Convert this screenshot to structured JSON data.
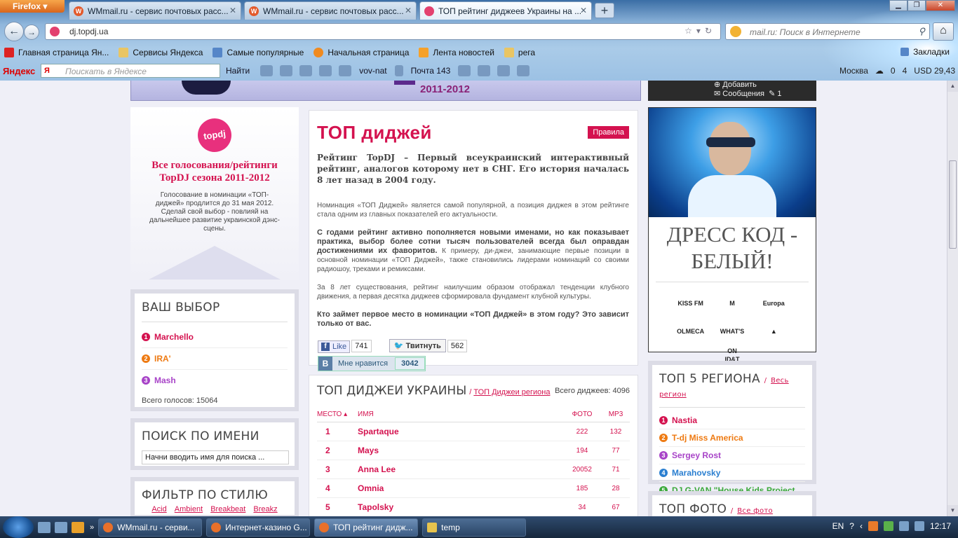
{
  "browser": {
    "app_button": "Firefox",
    "tabs": [
      {
        "title": "WMmail.ru - сервис почтовых расс...",
        "active": false
      },
      {
        "title": "WMmail.ru - сервис почтовых расс...",
        "active": false
      },
      {
        "title": "ТОП рейтинг диджеев Украины на ...",
        "active": true
      }
    ],
    "url": "dj.topdj.ua",
    "search_placeholder": "mail.ru: Поиск в Интернете",
    "bookmarks": [
      {
        "label": "Главная страница Ян...",
        "icon": "yandex-icon"
      },
      {
        "label": "Сервисы Яндекса",
        "icon": "folder-icon"
      },
      {
        "label": "Самые популярные",
        "icon": "popular-icon"
      },
      {
        "label": "Начальная страница",
        "icon": "firefox-icon"
      },
      {
        "label": "Лента новостей",
        "icon": "rss-icon"
      },
      {
        "label": "рега",
        "icon": "folder-icon"
      }
    ],
    "bookmarks_menu": "Закладки",
    "yandex_bar": {
      "logo": "Яндекс",
      "search_placeholder": "Поискать в Яндексе",
      "find_button": "Найти",
      "user": "vov-nat",
      "mail": "Почта 143",
      "city": "Москва",
      "weather_count": "0",
      "notifications": "4",
      "currency": "USD 29,43"
    }
  },
  "header": {
    "banner_years": "2011-2012",
    "user_add": "Добавить",
    "user_messages": "Сообщения",
    "messages_count": "1"
  },
  "promo": {
    "logo_text": "topdj",
    "title": "Все голосования/рейтинги TopDJ сезона 2011-2012",
    "text": "Голосование в номинации «ТОП-диджей» продлится до 31 мая 2012. Сделай свой выбор - повлияй на дальнейшее развитие украинской дэнс-сцены."
  },
  "your_choice": {
    "title": "ВАШ ВЫБОР",
    "items": [
      {
        "num": "1",
        "name": "Marchello",
        "color": "#d4124f"
      },
      {
        "num": "2",
        "name": "IRA'",
        "color": "#ee7a12"
      },
      {
        "num": "3",
        "name": "Mash",
        "color": "#a844c8"
      }
    ],
    "total": "Всего голосов: 15064"
  },
  "name_search": {
    "title": "ПОИСК ПО ИМЕНИ",
    "value": "Начни вводить имя для поиска ..."
  },
  "style_filter": {
    "title": "ФИЛЬТР ПО СТИЛЮ",
    "tags": [
      "Acid",
      "Ambient",
      "Breakbeat",
      "Breakz"
    ]
  },
  "main": {
    "title": "ТОП диджей",
    "rules_button": "Правила",
    "lead": "Рейтинг TopDJ – Первый всеукраинский интерактивный рейтинг, аналогов которому нет в СНГ. Его история началась 8 лет назад в 2004 году.",
    "p1": "Номинация «ТОП Диджей» является самой популярной, а позиция диджея в этом рейтинге стала одним из главных показателей его актуальности.",
    "p2_bold": "С годами рейтинг активно пополняется новыми именами, но как показывает практика, выбор более сотни тысяч пользователей всегда был оправдан достижениями их фаворитов.",
    "p2_rest": " К примеру, ди-джеи, занимающие первые позиции в основной номинации «ТОП Диджей», также становились лидерами номинаций со своими радиошоу, треками и ремиксами.",
    "p3": "За 8 лет существования, рейтинг наилучшим образом отображал тенденции клубного движения, а первая десятка диджеев сформировала фундамент клубной культуры.",
    "p4": "Кто займет первое место в номинации «ТОП Диджей» в этом году? Это зависит только от вас.",
    "fb_like": "Like",
    "fb_count": "741",
    "tweet": "Твитнуть",
    "tweet_count": "562",
    "vk_label": "Мне нравится",
    "vk_count": "3042"
  },
  "top_ukraine": {
    "title": "ТОП ДИДЖЕИ УКРАИНЫ",
    "region_link": "ТОП Диджеи региона",
    "total": "Всего диджеев: 4096",
    "columns": {
      "place": "МЕСТО",
      "name": "ИМЯ",
      "photo": "ФОТО",
      "mp3": "MP3"
    },
    "rows": [
      {
        "place": "1",
        "name": "Spartaque",
        "photo": "222",
        "mp3": "132"
      },
      {
        "place": "2",
        "name": "Mays",
        "photo": "194",
        "mp3": "77"
      },
      {
        "place": "3",
        "name": "Anna Lee",
        "photo": "20052",
        "mp3": "71"
      },
      {
        "place": "4",
        "name": "Omnia",
        "photo": "185",
        "mp3": "28"
      },
      {
        "place": "5",
        "name": "Tapolsky",
        "photo": "34",
        "mp3": "67"
      }
    ]
  },
  "ad": {
    "slogan": "ДРЕСС КОД - БЕЛЫЙ!",
    "logos": [
      "KISS FM",
      "M",
      "Europa",
      "OLMECA",
      "WHAT'S ON",
      "▲",
      "ID&T"
    ]
  },
  "regions": {
    "title": "ТОП 5 РЕГИОНА",
    "link": "Весь регион",
    "items": [
      {
        "num": "1",
        "name": "Nastia",
        "color": "#d4124f"
      },
      {
        "num": "2",
        "name": "T-dj Miss America",
        "color": "#ee7a12"
      },
      {
        "num": "3",
        "name": "Sergey Rost",
        "color": "#a844c8"
      },
      {
        "num": "4",
        "name": "Marahovsky",
        "color": "#2b7fd0"
      },
      {
        "num": "5",
        "name": "DJ G-VAN \"House Kids Project",
        "color": "#3aa83a"
      }
    ]
  },
  "photos": {
    "title": "ТОП ФОТО",
    "link": "Все фото"
  },
  "taskbar": {
    "tasks": [
      {
        "title": "WMmail.ru - серви...",
        "icon": "firefox-icon",
        "active": false
      },
      {
        "title": "Интернет-казино G...",
        "icon": "firefox-icon",
        "active": false
      },
      {
        "title": "ТОП рейтинг дидж...",
        "icon": "firefox-icon",
        "active": true
      },
      {
        "title": "temp",
        "icon": "folder-icon",
        "active": false
      }
    ],
    "lang": "EN",
    "time": "12:17"
  }
}
